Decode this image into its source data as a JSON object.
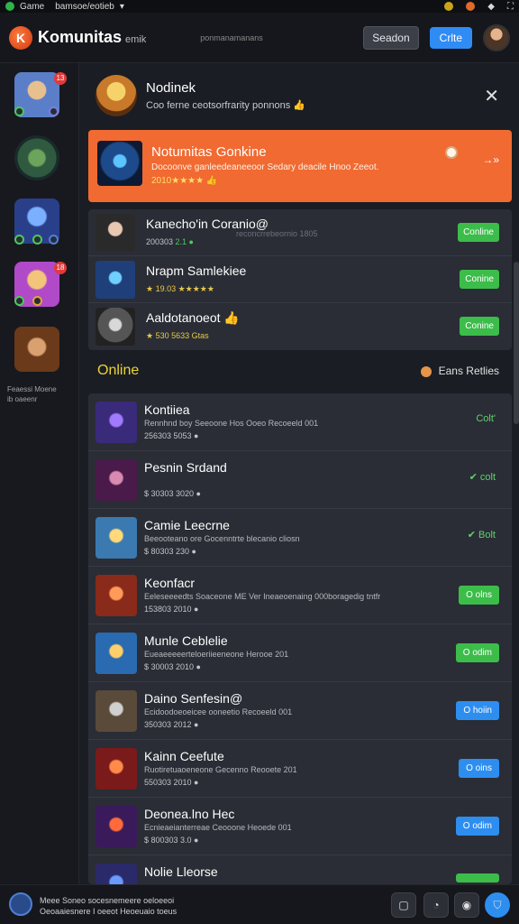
{
  "status_bar": {
    "app": "Game",
    "url": "bamsoe/eotieb"
  },
  "header": {
    "brand": "Komunitas",
    "brand_sub": "emik",
    "center_text": "ponmanamanans",
    "session_btn": "Seadon",
    "primary_btn": "Crlte"
  },
  "sidebar": {
    "badges": [
      "13",
      "18"
    ],
    "footer_text_1": "Feaessi Moene",
    "footer_text_2": "ib oaeenr"
  },
  "notification": {
    "title": "Nodinek",
    "subtitle": "Coo ferne ceotsorfrarity ponnons 👍"
  },
  "featured": {
    "title": "Notumitas Gonkine",
    "subtitle": "Docoonve ganleedeaneeoor Sedary deacile Hnoo Zeeot.",
    "stars": "2010★★★★ 👍",
    "arrow": "→»"
  },
  "top_list": [
    {
      "title": "Kanecho'in Coranio@",
      "meta_left": "200303 ",
      "meta_right": "2.1 ●",
      "extra": "reconcrrebeornio 1805",
      "btn": "Conline"
    },
    {
      "title": "Nrapm Samlekiee",
      "meta_left": "★ 19.03 ",
      "meta_right": "★★★★★",
      "extra": "",
      "btn": "Conine"
    },
    {
      "title": "Aaldotanoeot 👍",
      "meta_left": "★ 530 ",
      "meta_right": "5633 Gtas",
      "extra": "",
      "btn": "Conine"
    }
  ],
  "online": {
    "title": "Online",
    "right_label": "Eans Retlies"
  },
  "online_list": [
    {
      "title": "Kontiiea",
      "desc": "Rennhnd boy Seeoone Hos Ooeo Recoeeld 001",
      "meta": "256303 5053 ●",
      "status": "Colt'",
      "btn": "",
      "btn_color": ""
    },
    {
      "title": "Pesnin Srdand",
      "desc": "",
      "meta": "$ 30303 3020 ●",
      "status": "✔ colt",
      "btn": "",
      "btn_color": ""
    },
    {
      "title": "Camie Leecrne",
      "desc": "Beeooteano ore Gocenntrte blecanio cliosn",
      "meta": "$ 80303 230 ●",
      "status": "✔ Bolt",
      "btn": "",
      "btn_color": ""
    },
    {
      "title": "Keonfacr",
      "desc": "Eeleseeeedts Soaceone ME Ver Ineaeoenaing 000boragedig tntfr",
      "meta": "153803 2010 ●",
      "status": "",
      "btn": "O olns",
      "btn_color": "green"
    },
    {
      "title": "Munle Ceblelie",
      "desc": "Eueaeeeeerteloeriieeneone Herooe 201",
      "meta": "$ 30003 2010 ●",
      "status": "",
      "btn": "O odim",
      "btn_color": "green"
    },
    {
      "title": "Daino Senfesin@",
      "desc": "Ecidoodoeoeicee ooneetio Recoeeld 001",
      "meta": "350303 2012 ●",
      "status": "",
      "btn": "O hoiin",
      "btn_color": "blue"
    },
    {
      "title": "Kainn Ceefute",
      "desc": "Ruotiretuaoeneone Gecenno Reooete 201",
      "meta": "550303 2010 ●",
      "status": "",
      "btn": "O oins",
      "btn_color": "blue"
    },
    {
      "title": "Deonea.lno Hec",
      "desc": "Ecnieaeianterreae Ceooone Heoede 001",
      "meta": "$ 800303 3.0 ●",
      "status": "",
      "btn": "O odim",
      "btn_color": "blue"
    },
    {
      "title": "Nolie Lleorse",
      "desc": "",
      "meta": "",
      "status": "",
      "btn": "",
      "btn_color": "green"
    }
  ],
  "footer": {
    "line1": "Meee Soneo socesnemeere oeloeeoi",
    "line2": "Oeoaaiesnere I oeeot Heoeuaio toeus"
  }
}
